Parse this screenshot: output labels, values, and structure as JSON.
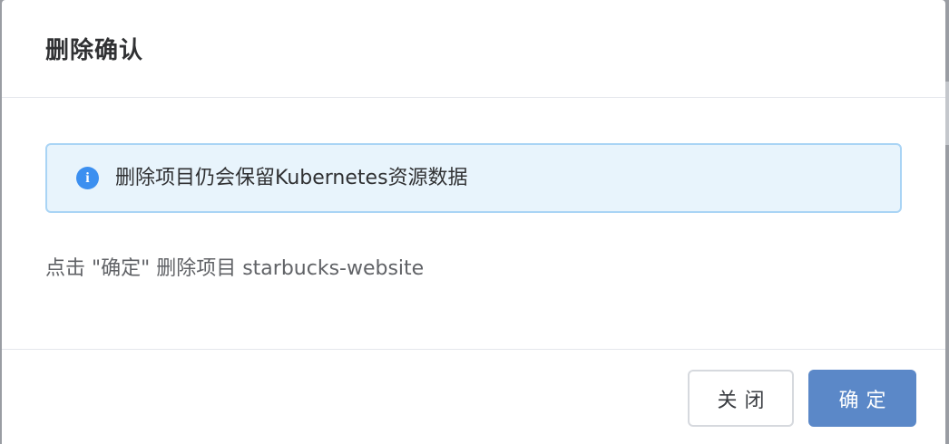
{
  "dialog": {
    "title": "删除确认",
    "alert": {
      "icon": "info-icon",
      "icon_glyph": "i",
      "message": "删除项目仍会保留Kubernetes资源数据",
      "color": "#3b8ff0"
    },
    "confirm_message": "点击 \"确定\" 删除项目 starbucks-website",
    "buttons": {
      "close_label": "关闭",
      "confirm_label": "确定"
    },
    "colors": {
      "primary": "#5b88c8",
      "alert_background": "#e8f4fc",
      "alert_border": "#a9d4f5"
    }
  }
}
